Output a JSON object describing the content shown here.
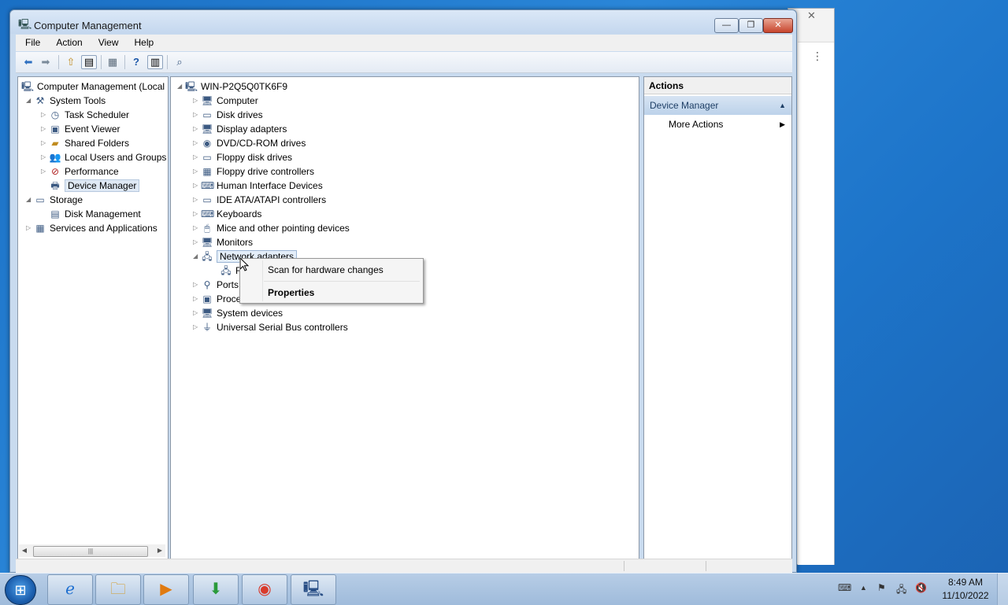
{
  "window": {
    "title": "Computer Management",
    "caption_min": "—",
    "caption_max": "❐",
    "caption_close": "✕"
  },
  "menu": [
    "File",
    "Action",
    "View",
    "Help"
  ],
  "toolbar": {
    "back_icon": "back-arrow-icon",
    "forward_icon": "forward-arrow-icon"
  },
  "left_tree": {
    "root": "Computer Management (Local",
    "system_tools": "System Tools",
    "task_scheduler": "Task Scheduler",
    "event_viewer": "Event Viewer",
    "shared_folders": "Shared Folders",
    "local_users": "Local Users and Groups",
    "performance": "Performance",
    "device_manager": "Device Manager",
    "storage": "Storage",
    "disk_management": "Disk Management",
    "services": "Services and Applications"
  },
  "device_tree": {
    "root": "WIN-P2Q5Q0TK6F9",
    "items": [
      "Computer",
      "Disk drives",
      "Display adapters",
      "DVD/CD-ROM drives",
      "Floppy disk drives",
      "Floppy drive controllers",
      "Human Interface Devices",
      "IDE ATA/ATAPI controllers",
      "Keyboards",
      "Mice and other pointing devices",
      "Monitors",
      "Network adapters",
      "R",
      "Ports",
      "Proce",
      "System devices",
      "Universal Serial Bus controllers"
    ]
  },
  "actions": {
    "header": "Actions",
    "group": "Device Manager",
    "more": "More Actions"
  },
  "context_menu": {
    "scan": "Scan for hardware changes",
    "properties": "Properties"
  },
  "tray": {
    "time": "8:49 AM",
    "date": "11/10/2022"
  },
  "colors": {
    "desktop": "#1d74c9",
    "window_frame": "#c9dbef",
    "actions_group": "#bcd2ea"
  }
}
